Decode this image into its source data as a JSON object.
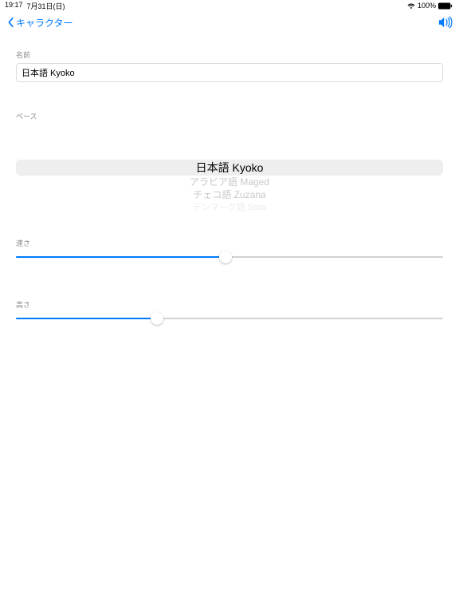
{
  "status_bar": {
    "time": "19:17",
    "date": "7月31日(日)",
    "battery": "100%"
  },
  "nav": {
    "back_label": "キャラクター"
  },
  "sections": {
    "name_label": "名前",
    "name_value": "日本語 Kyoko",
    "base_label": "ベース",
    "speed_label": "速さ",
    "pitch_label": "高さ"
  },
  "picker": {
    "items": [
      "日本語 Kyoko",
      "アラビア語 Maged",
      "チェコ語 Zuzana",
      "デンマーク語 Sara"
    ],
    "selected_index": 0
  },
  "sliders": {
    "speed_percent": 49,
    "pitch_percent": 33
  }
}
